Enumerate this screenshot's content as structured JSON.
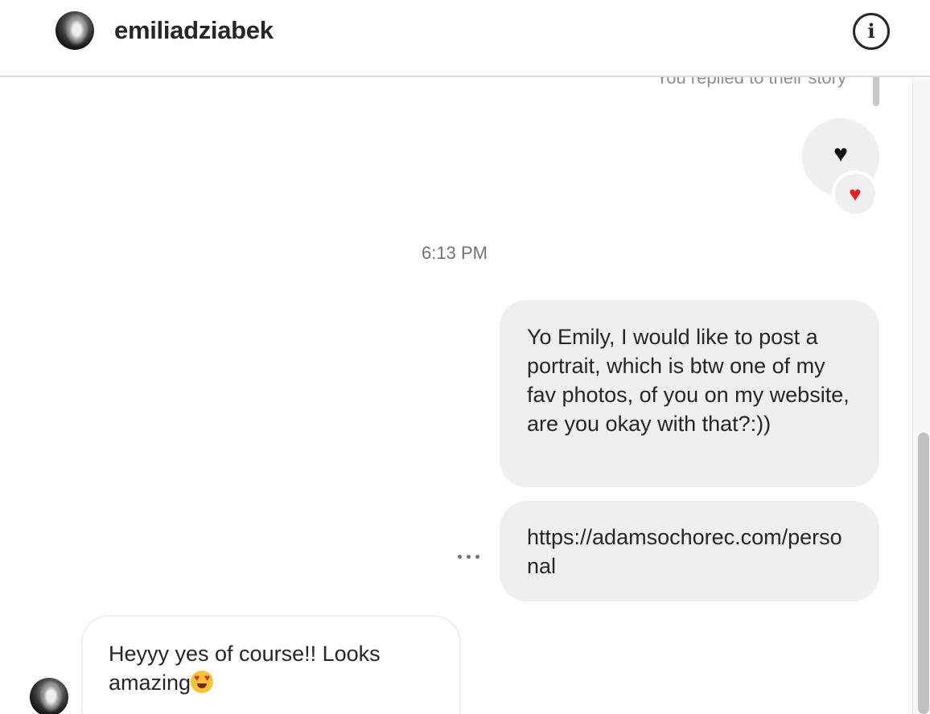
{
  "header": {
    "username": "emiliadziabek",
    "info_icon": "info-icon"
  },
  "thread": {
    "story_note": "You replied to their story",
    "story_reply_emoji": "🖤",
    "reaction_emoji": "❤️",
    "timestamp": "6:13 PM",
    "messages": [
      {
        "direction": "outgoing",
        "text": "Yo Emily, I would like to post a portrait, which is btw one of my fav photos, of you on my website, are you okay with that?:))"
      },
      {
        "direction": "outgoing",
        "text": "https://adamsochorec.com/personal"
      },
      {
        "direction": "incoming",
        "text": "Heyyy yes of course!! Looks amazing",
        "emoji": "heart-eyes-emoji"
      }
    ]
  },
  "colors": {
    "bubble_gray": "#efefef",
    "text": "#262626",
    "muted": "#8e8e8e"
  }
}
